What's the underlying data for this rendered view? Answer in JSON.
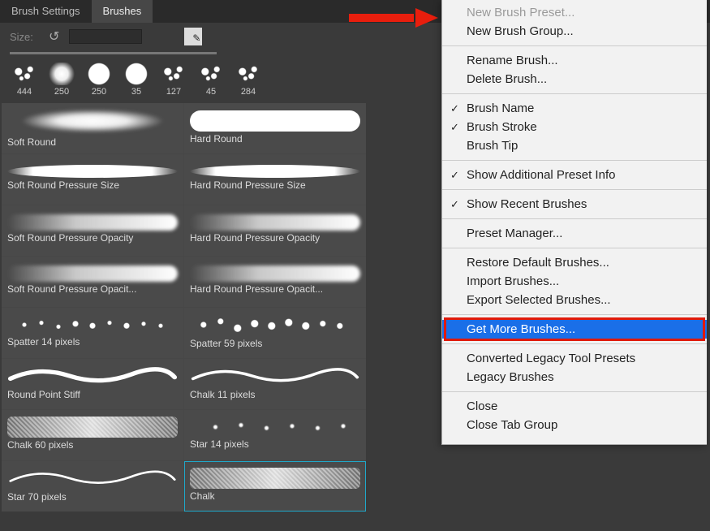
{
  "tabs": {
    "settings": "Brush Settings",
    "brushes": "Brushes"
  },
  "size_row": {
    "label": "Size:",
    "value": ""
  },
  "recent": [
    {
      "size": "444",
      "kind": "splat"
    },
    {
      "size": "250",
      "kind": "soft"
    },
    {
      "size": "250",
      "kind": "hard"
    },
    {
      "size": "35",
      "kind": "hard"
    },
    {
      "size": "127",
      "kind": "splat"
    },
    {
      "size": "45",
      "kind": "splat"
    },
    {
      "size": "284",
      "kind": "splat"
    }
  ],
  "grid": [
    {
      "label": "Soft Round",
      "stroke": "stroke-soft"
    },
    {
      "label": "Hard Round",
      "stroke": "stroke-hard"
    },
    {
      "label": "Soft Round Pressure Size",
      "stroke": "stroke-taper"
    },
    {
      "label": "Hard Round Pressure Size",
      "stroke": "stroke-taper"
    },
    {
      "label": "Soft Round Pressure Opacity",
      "stroke": "stroke-fade"
    },
    {
      "label": "Hard Round Pressure Opacity",
      "stroke": "stroke-fade"
    },
    {
      "label": "Soft Round Pressure Opacit...",
      "stroke": "stroke-fade"
    },
    {
      "label": "Hard Round Pressure Opacit...",
      "stroke": "stroke-fade"
    },
    {
      "label": "Spatter 14 pixels",
      "stroke": "stroke-spatter"
    },
    {
      "label": "Spatter 59 pixels",
      "stroke": "stroke-spatter2"
    },
    {
      "label": "Round Point Stiff",
      "stroke": "wavy"
    },
    {
      "label": "Chalk 11 pixels",
      "stroke": "wavy"
    },
    {
      "label": "Chalk 60 pixels",
      "stroke": "stroke-chalk"
    },
    {
      "label": "Star 14 pixels",
      "stroke": "stroke-star"
    },
    {
      "label": "Star 70 pixels",
      "stroke": "wavy"
    },
    {
      "label": "Chalk",
      "stroke": "stroke-chalk",
      "selected": true
    }
  ],
  "menu": {
    "groups": [
      [
        {
          "label": "New Brush Preset...",
          "disabled": true
        },
        {
          "label": "New Brush Group..."
        }
      ],
      [
        {
          "label": "Rename Brush..."
        },
        {
          "label": "Delete Brush..."
        }
      ],
      [
        {
          "label": "Brush Name",
          "checked": true
        },
        {
          "label": "Brush Stroke",
          "checked": true
        },
        {
          "label": "Brush Tip"
        }
      ],
      [
        {
          "label": "Show Additional Preset Info",
          "checked": true
        }
      ],
      [
        {
          "label": "Show Recent Brushes",
          "checked": true
        }
      ],
      [
        {
          "label": "Preset Manager..."
        }
      ],
      [
        {
          "label": "Restore Default Brushes..."
        },
        {
          "label": "Import Brushes..."
        },
        {
          "label": "Export Selected Brushes..."
        }
      ],
      [
        {
          "label": "Get More Brushes...",
          "highlighted": true,
          "boxed": true
        }
      ],
      [
        {
          "label": "Converted Legacy Tool Presets"
        },
        {
          "label": "Legacy Brushes"
        }
      ],
      [
        {
          "label": "Close"
        },
        {
          "label": "Close Tab Group"
        }
      ]
    ]
  }
}
